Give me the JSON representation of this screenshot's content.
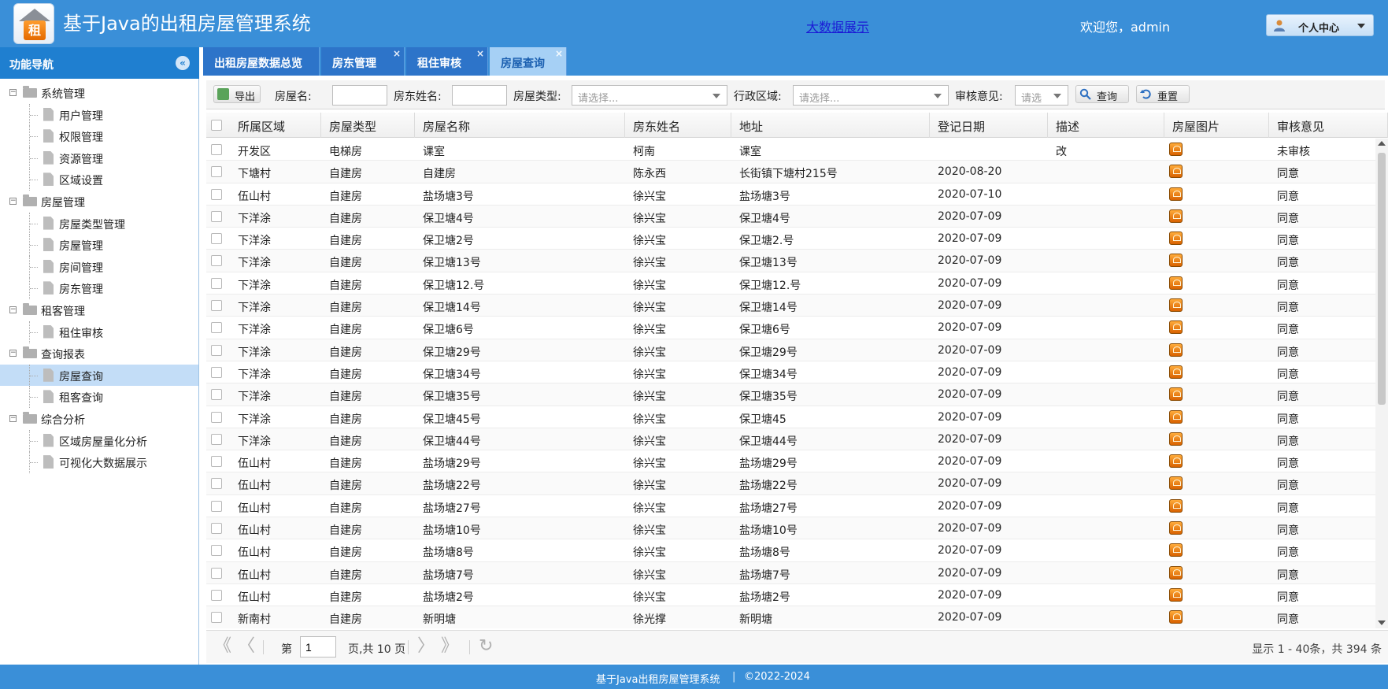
{
  "header": {
    "logo_char": "租",
    "title": "基于Java的出租房屋管理系统",
    "bigdata_link": "大数据展示",
    "welcome": "欢迎您，admin",
    "user_menu": "个人中心"
  },
  "sidebar": {
    "title": "功能导航",
    "collapse_icon": "«",
    "tree": [
      {
        "label": "系统管理",
        "level": 0
      },
      {
        "label": "用户管理",
        "level": 1
      },
      {
        "label": "权限管理",
        "level": 1
      },
      {
        "label": "资源管理",
        "level": 1
      },
      {
        "label": "区域设置",
        "level": 1
      },
      {
        "label": "房屋管理",
        "level": 0
      },
      {
        "label": "房屋类型管理",
        "level": 1
      },
      {
        "label": "房屋管理",
        "level": 1
      },
      {
        "label": "房间管理",
        "level": 1
      },
      {
        "label": "房东管理",
        "level": 1
      },
      {
        "label": "租客管理",
        "level": 0
      },
      {
        "label": "租住审核",
        "level": 1
      },
      {
        "label": "查询报表",
        "level": 0
      },
      {
        "label": "房屋查询",
        "level": 1,
        "selected": true
      },
      {
        "label": "租客查询",
        "level": 1
      },
      {
        "label": "综合分析",
        "level": 0
      },
      {
        "label": "区域房屋量化分析",
        "level": 1
      },
      {
        "label": "可视化大数据展示",
        "level": 1
      }
    ]
  },
  "tabs": [
    {
      "label": "出租房屋数据总览",
      "closable": false
    },
    {
      "label": "房东管理",
      "closable": true
    },
    {
      "label": "租住审核",
      "closable": true
    },
    {
      "label": "房屋查询",
      "closable": true,
      "active": true
    }
  ],
  "toolbar": {
    "export_label": "导出",
    "house_name_label": "房屋名:",
    "house_name_value": "",
    "landlord_label": "房东姓名:",
    "landlord_value": "",
    "house_type_label": "房屋类型:",
    "house_type_placeholder": "请选择...",
    "district_label": "行政区域:",
    "district_placeholder": "请选择...",
    "review_label": "审核意见:",
    "review_placeholder": "请选",
    "query_label": "查询",
    "reset_label": "重置"
  },
  "table": {
    "columns": [
      "所属区域",
      "房屋类型",
      "房屋名称",
      "房东姓名",
      "地址",
      "登记日期",
      "描述",
      "房屋图片",
      "审核意见"
    ],
    "rows": [
      [
        "开发区",
        "电梯房",
        "课室",
        "柯南",
        "课室",
        "",
        "改",
        "img",
        "未审核"
      ],
      [
        "下塘村",
        "自建房",
        "自建房",
        "陈永西",
        "长街镇下塘村215号",
        "2020-08-20",
        "",
        "img",
        "同意"
      ],
      [
        "伍山村",
        "自建房",
        "盐场塘3号",
        "徐兴宝",
        "盐场塘3号",
        "2020-07-10",
        "",
        "img",
        "同意"
      ],
      [
        "下洋涂",
        "自建房",
        "保卫塘4号",
        "徐兴宝",
        "保卫塘4号",
        "2020-07-09",
        "",
        "img",
        "同意"
      ],
      [
        "下洋涂",
        "自建房",
        "保卫塘2号",
        "徐兴宝",
        "保卫塘2.号",
        "2020-07-09",
        "",
        "img",
        "同意"
      ],
      [
        "下洋涂",
        "自建房",
        "保卫塘13号",
        "徐兴宝",
        "保卫塘13号",
        "2020-07-09",
        "",
        "img",
        "同意"
      ],
      [
        "下洋涂",
        "自建房",
        "保卫塘12.号",
        "徐兴宝",
        "保卫塘12.号",
        "2020-07-09",
        "",
        "img",
        "同意"
      ],
      [
        "下洋涂",
        "自建房",
        "保卫塘14号",
        "徐兴宝",
        "保卫塘14号",
        "2020-07-09",
        "",
        "img",
        "同意"
      ],
      [
        "下洋涂",
        "自建房",
        "保卫塘6号",
        "徐兴宝",
        "保卫塘6号",
        "2020-07-09",
        "",
        "img",
        "同意"
      ],
      [
        "下洋涂",
        "自建房",
        "保卫塘29号",
        "徐兴宝",
        "保卫塘29号",
        "2020-07-09",
        "",
        "img",
        "同意"
      ],
      [
        "下洋涂",
        "自建房",
        "保卫塘34号",
        "徐兴宝",
        "保卫塘34号",
        "2020-07-09",
        "",
        "img",
        "同意"
      ],
      [
        "下洋涂",
        "自建房",
        "保卫塘35号",
        "徐兴宝",
        "保卫塘35号",
        "2020-07-09",
        "",
        "img",
        "同意"
      ],
      [
        "下洋涂",
        "自建房",
        "保卫塘45号",
        "徐兴宝",
        "保卫塘45",
        "2020-07-09",
        "",
        "img",
        "同意"
      ],
      [
        "下洋涂",
        "自建房",
        "保卫塘44号",
        "徐兴宝",
        "保卫塘44号",
        "2020-07-09",
        "",
        "img",
        "同意"
      ],
      [
        "伍山村",
        "自建房",
        "盐场塘29号",
        "徐兴宝",
        "盐场塘29号",
        "2020-07-09",
        "",
        "img",
        "同意"
      ],
      [
        "伍山村",
        "自建房",
        "盐场塘22号",
        "徐兴宝",
        "盐场塘22号",
        "2020-07-09",
        "",
        "img",
        "同意"
      ],
      [
        "伍山村",
        "自建房",
        "盐场塘27号",
        "徐兴宝",
        "盐场塘27号",
        "2020-07-09",
        "",
        "img",
        "同意"
      ],
      [
        "伍山村",
        "自建房",
        "盐场塘10号",
        "徐兴宝",
        "盐场塘10号",
        "2020-07-09",
        "",
        "img",
        "同意"
      ],
      [
        "伍山村",
        "自建房",
        "盐场塘8号",
        "徐兴宝",
        "盐场塘8号",
        "2020-07-09",
        "",
        "img",
        "同意"
      ],
      [
        "伍山村",
        "自建房",
        "盐场塘7号",
        "徐兴宝",
        "盐场塘7号",
        "2020-07-09",
        "",
        "img",
        "同意"
      ],
      [
        "伍山村",
        "自建房",
        "盐场塘2号",
        "徐兴宝",
        "盐场塘2号",
        "2020-07-09",
        "",
        "img",
        "同意"
      ],
      [
        "新南村",
        "自建房",
        "新明塘",
        "徐光撑",
        "新明塘",
        "2020-07-09",
        "",
        "img",
        "同意"
      ]
    ]
  },
  "pager": {
    "page_prefix": "第",
    "page_value": "1",
    "page_suffix": "页,共 10 页",
    "info": "显示 1 - 40条，共 394 条",
    "first_icon": "《",
    "prev_icon": "〈",
    "next_icon": "〉",
    "last_icon": "》",
    "refresh_icon": "↻"
  },
  "footer": {
    "system": "基于Java出租房屋管理系统",
    "copyright": "©2022-2024"
  }
}
